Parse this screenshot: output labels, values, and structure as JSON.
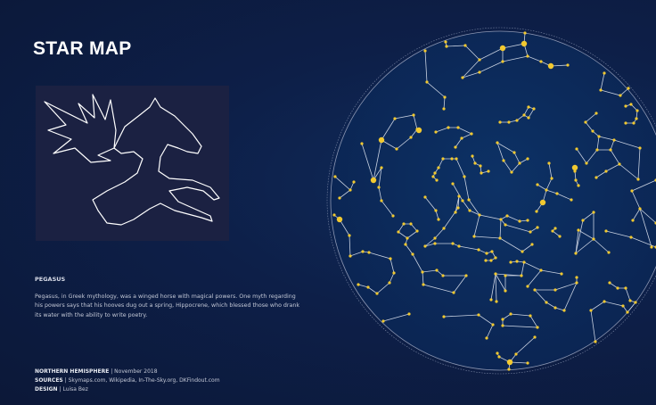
{
  "title": "STAR MAP",
  "constellation": {
    "name": "PEGASUS",
    "description": "Pegasus, in Greek mythology, was a winged horse with magical powers. One myth regarding his powers says that his hooves dug out a spring, Hippocrene, which blessed those who drank its water with the ability to write poetry."
  },
  "footer": {
    "hemisphere_label": "NORTHERN HEMISPHERE",
    "hemisphere_value": "November 2018",
    "sources_label": "SOURCES",
    "sources_value": "Skymaps.com, Wikipedia, In-The-Sky.org, DKFindout.com",
    "design_label": "DESIGN",
    "design_value": "Luisa Bez",
    "separator": "|"
  },
  "colors": {
    "star": "#f2c930",
    "line": "#c9d1e0",
    "background": "#0d1f48"
  }
}
